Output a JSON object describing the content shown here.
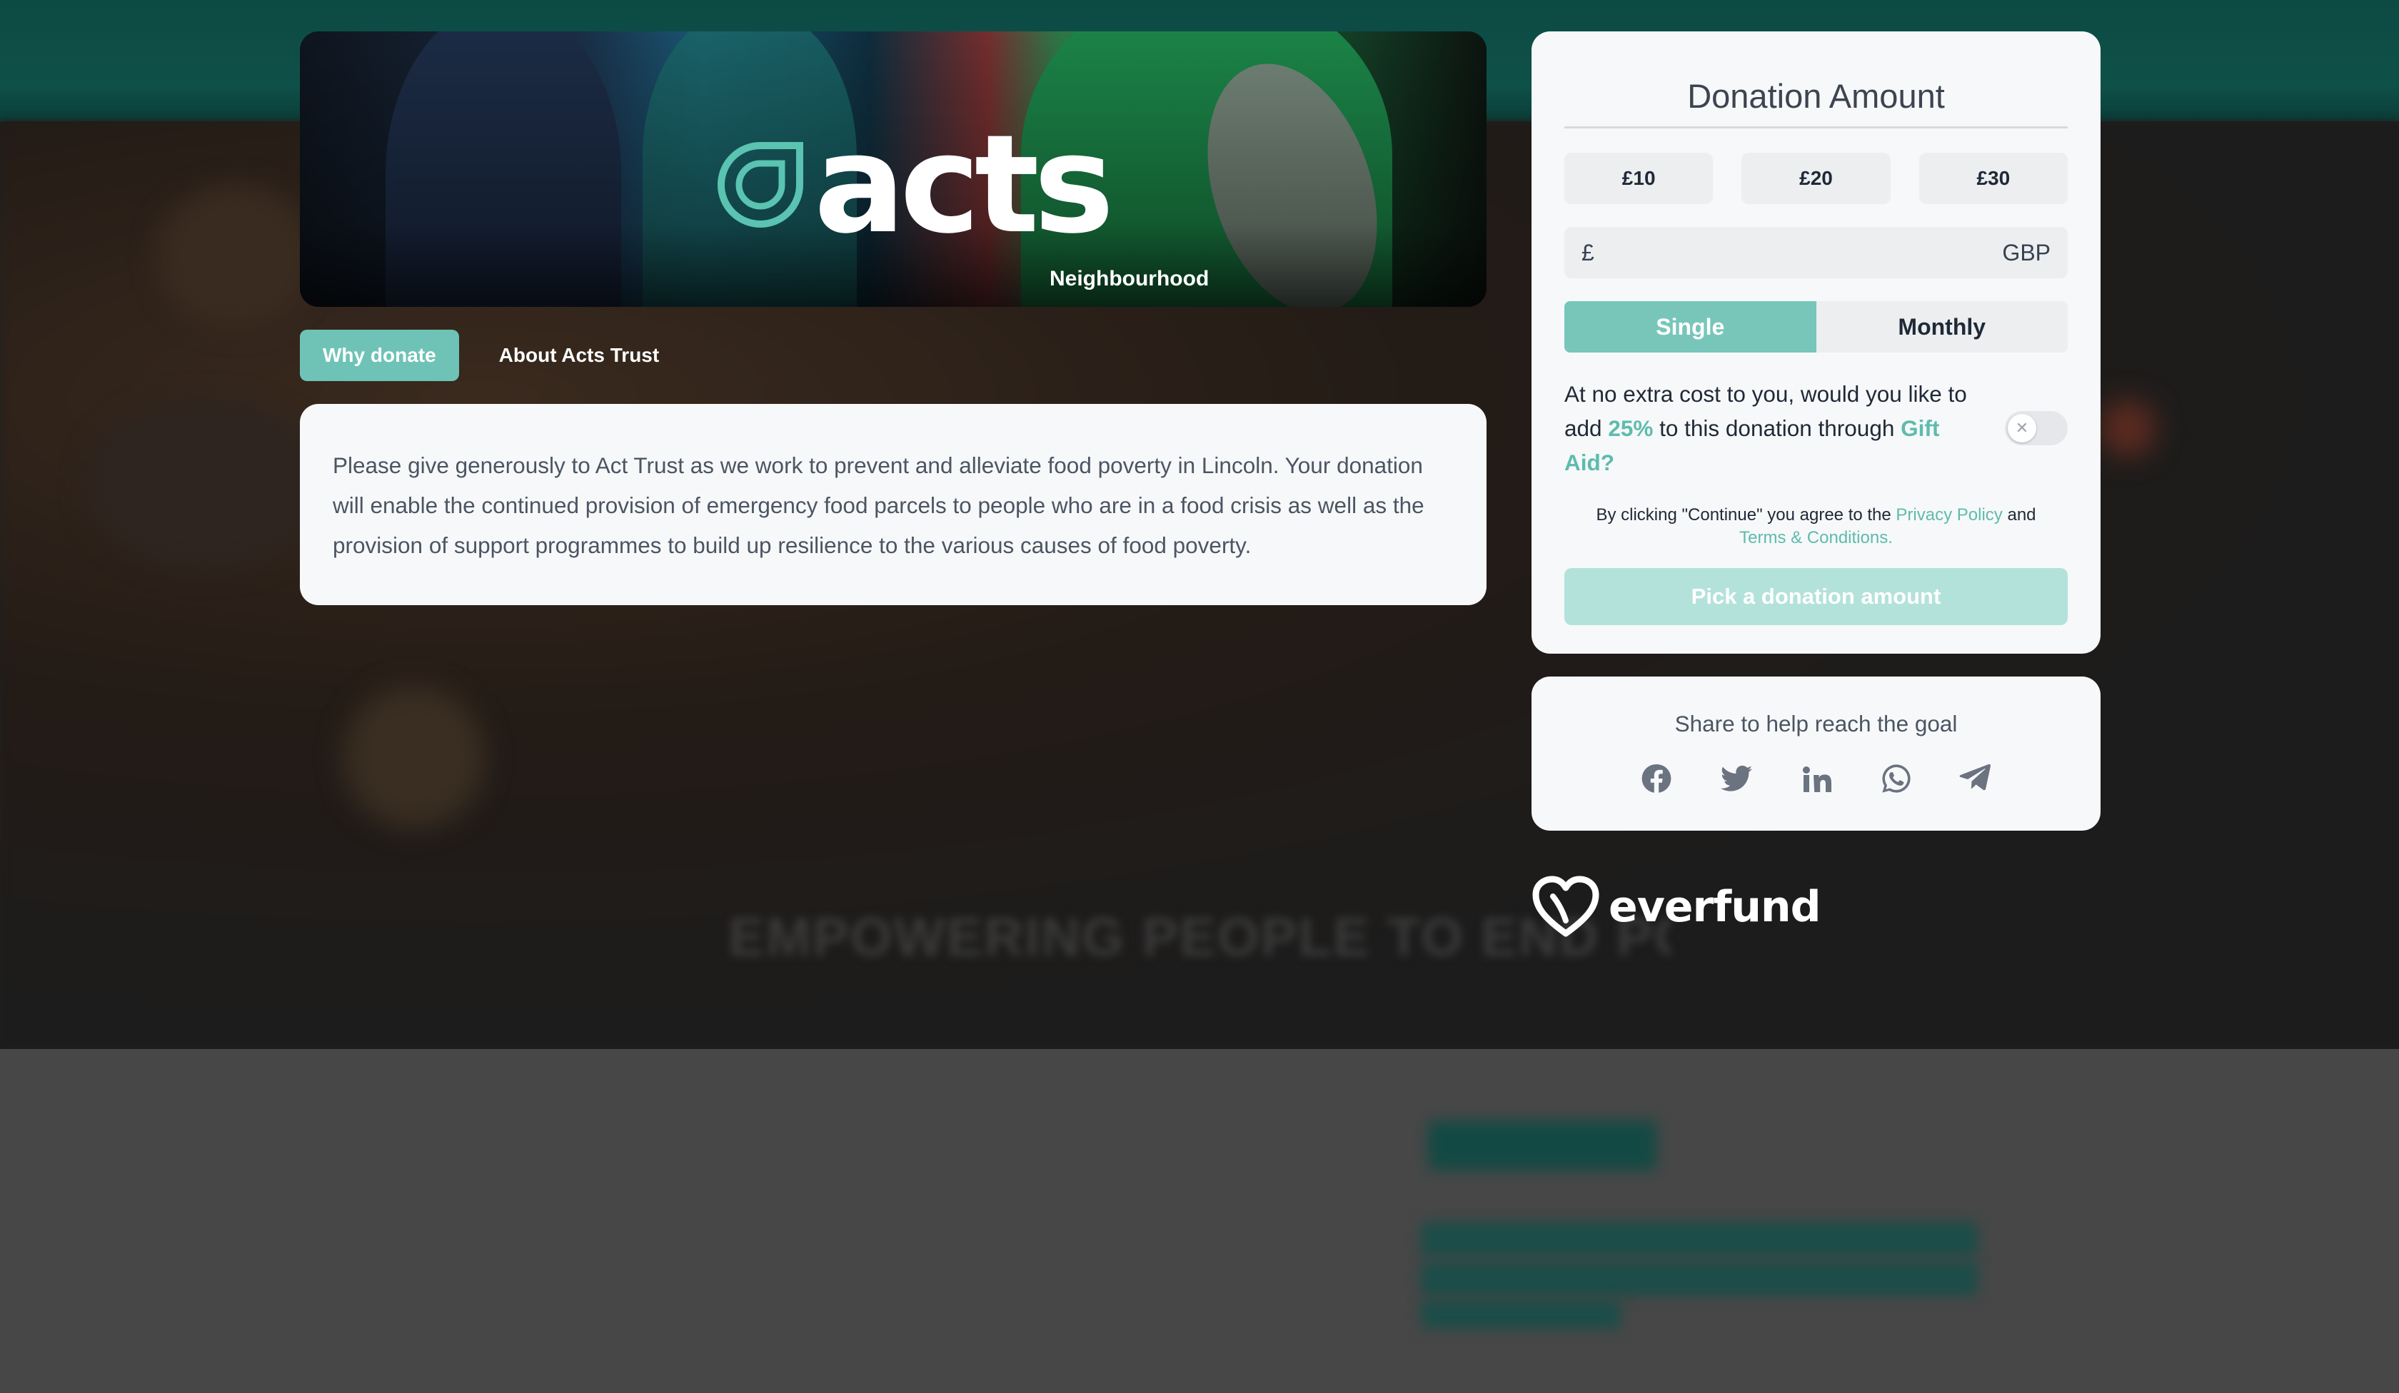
{
  "hero": {
    "logo_text": "acts",
    "bag_label": "Neighbourhood"
  },
  "tabs": [
    {
      "label": "Why donate",
      "active": true
    },
    {
      "label": "About Acts Trust",
      "active": false
    }
  ],
  "description": "Please give generously to Act Trust as we work to prevent and alleviate food poverty in Lincoln. Your donation will enable the continued provision of emergency food parcels to people who are in a food crisis as well as the provision of support programmes to build up resilience to the various causes of food poverty.",
  "donation": {
    "title": "Donation Amount",
    "amounts": [
      "£10",
      "£20",
      "£30"
    ],
    "currency_symbol": "£",
    "custom_value": "",
    "currency_code": "GBP",
    "frequency": [
      {
        "label": "Single",
        "active": true
      },
      {
        "label": "Monthly",
        "active": false
      }
    ],
    "gift_aid": {
      "text_before": "At no extra cost to you, would you like to add ",
      "percent": "25%",
      "text_middle": " to this donation through ",
      "link": "Gift Aid?",
      "enabled": false,
      "toggle_glyph": "✕"
    },
    "legal": {
      "prefix": "By clicking \"Continue\" you agree to the ",
      "privacy": "Privacy Policy",
      "and": " and",
      "terms": "Terms & Conditions."
    },
    "continue_label": "Pick a donation amount"
  },
  "share": {
    "title": "Share to help reach the goal",
    "icons": [
      "facebook-icon",
      "twitter-icon",
      "linkedin-icon",
      "whatsapp-icon",
      "telegram-icon"
    ]
  },
  "brand": {
    "name": "everfund"
  },
  "background": {
    "slogan": "EMPOWERING PEOPLE TO END POVERTY"
  },
  "colors": {
    "accent": "#6fc3b6",
    "accent_light": "#b3e2db",
    "card_bg": "#f7f8f9",
    "header_bg": "#0e5149"
  }
}
